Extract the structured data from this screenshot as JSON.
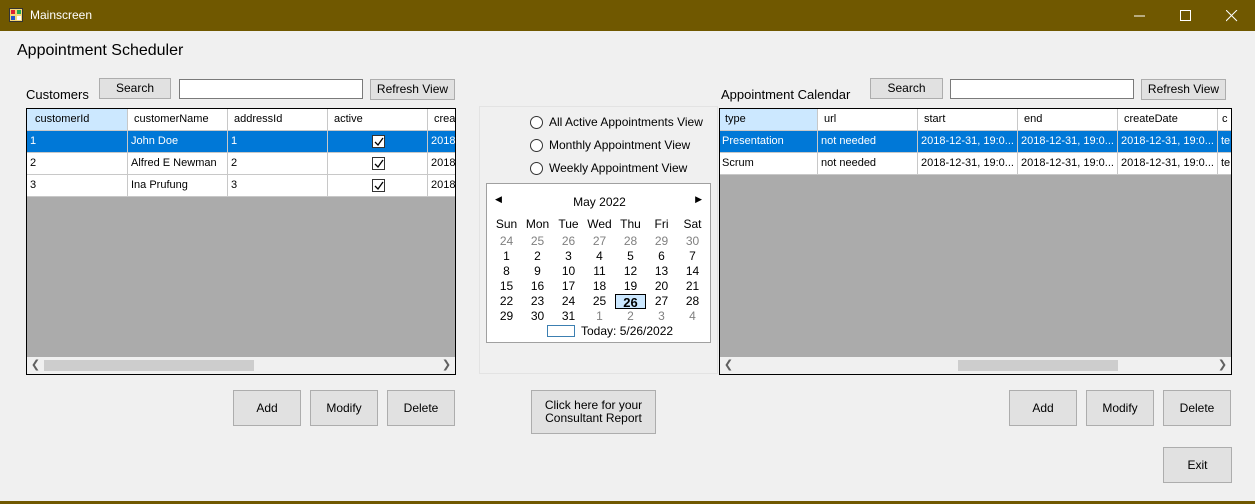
{
  "window": {
    "title": "Mainscreen",
    "titlebar_color": "#705800"
  },
  "app_title": "Appointment Scheduler",
  "customers": {
    "label": "Customers",
    "search_button": "Search",
    "search_value": "",
    "refresh_button": "Refresh View",
    "columns": [
      "customerId",
      "customerName",
      "addressId",
      "active",
      "crea"
    ],
    "rows": [
      {
        "customerId": "1",
        "customerName": "John Doe",
        "addressId": "1",
        "active": true,
        "created": "2018",
        "selected": true
      },
      {
        "customerId": "2",
        "customerName": "Alfred E Newman",
        "addressId": "2",
        "active": true,
        "created": "2018",
        "selected": false
      },
      {
        "customerId": "3",
        "customerName": "Ina Prufung",
        "addressId": "3",
        "active": true,
        "created": "2018",
        "selected": false
      }
    ],
    "add_button": "Add",
    "modify_button": "Modify",
    "delete_button": "Delete"
  },
  "views": {
    "options": [
      "All Active Appointments View",
      "Monthly Appointment View",
      "Weekly Appointment View"
    ],
    "selected": null
  },
  "calendar": {
    "month_label": "May 2022",
    "weekdays": [
      "Sun",
      "Mon",
      "Tue",
      "Wed",
      "Thu",
      "Fri",
      "Sat"
    ],
    "weeks": [
      [
        {
          "d": "24",
          "o": true
        },
        {
          "d": "25",
          "o": true
        },
        {
          "d": "26",
          "o": true
        },
        {
          "d": "27",
          "o": true
        },
        {
          "d": "28",
          "o": true
        },
        {
          "d": "29",
          "o": true
        },
        {
          "d": "30",
          "o": true
        }
      ],
      [
        {
          "d": "1"
        },
        {
          "d": "2"
        },
        {
          "d": "3"
        },
        {
          "d": "4"
        },
        {
          "d": "5"
        },
        {
          "d": "6"
        },
        {
          "d": "7"
        }
      ],
      [
        {
          "d": "8"
        },
        {
          "d": "9"
        },
        {
          "d": "10"
        },
        {
          "d": "11"
        },
        {
          "d": "12"
        },
        {
          "d": "13"
        },
        {
          "d": "14"
        }
      ],
      [
        {
          "d": "15"
        },
        {
          "d": "16"
        },
        {
          "d": "17"
        },
        {
          "d": "18"
        },
        {
          "d": "19"
        },
        {
          "d": "20"
        },
        {
          "d": "21"
        }
      ],
      [
        {
          "d": "22"
        },
        {
          "d": "23"
        },
        {
          "d": "24"
        },
        {
          "d": "25"
        },
        {
          "d": "26",
          "today": true
        },
        {
          "d": "27"
        },
        {
          "d": "28"
        }
      ],
      [
        {
          "d": "29"
        },
        {
          "d": "30"
        },
        {
          "d": "31"
        },
        {
          "d": "1",
          "o": true
        },
        {
          "d": "2",
          "o": true
        },
        {
          "d": "3",
          "o": true
        },
        {
          "d": "4",
          "o": true
        }
      ]
    ],
    "today_label": "Today: 5/26/2022"
  },
  "report_button": [
    "Click here for your",
    "Consultant Report"
  ],
  "appointments": {
    "label": "Appointment Calendar",
    "search_button": "Search",
    "search_value": "",
    "refresh_button": "Refresh View",
    "columns": [
      "type",
      "url",
      "start",
      "end",
      "createDate",
      "c"
    ],
    "rows": [
      {
        "type": "Presentation",
        "url": "not needed",
        "start": "2018-12-31, 19:0...",
        "end": "2018-12-31, 19:0...",
        "createDate": "2018-12-31, 19:0...",
        "extra": "te",
        "selected": true
      },
      {
        "type": "Scrum",
        "url": "not needed",
        "start": "2018-12-31, 19:0...",
        "end": "2018-12-31, 19:0...",
        "createDate": "2018-12-31, 19:0...",
        "extra": "te",
        "selected": false
      }
    ],
    "add_button": "Add",
    "modify_button": "Modify",
    "delete_button": "Delete"
  },
  "exit_button": "Exit",
  "icons": {
    "app": "app-window-icon",
    "minimize": "minimize-icon",
    "maximize": "maximize-icon",
    "close": "close-icon",
    "checkbox": "checkmark-icon",
    "scroll_left": "scroll-left-arrow-icon",
    "scroll_right": "scroll-right-arrow-icon",
    "cal_prev": "calendar-prev-icon",
    "cal_next": "calendar-next-icon"
  },
  "colors": {
    "selected_row": "#0078d7",
    "selected_header": "#cce8ff",
    "grid_background": "#ababab"
  }
}
